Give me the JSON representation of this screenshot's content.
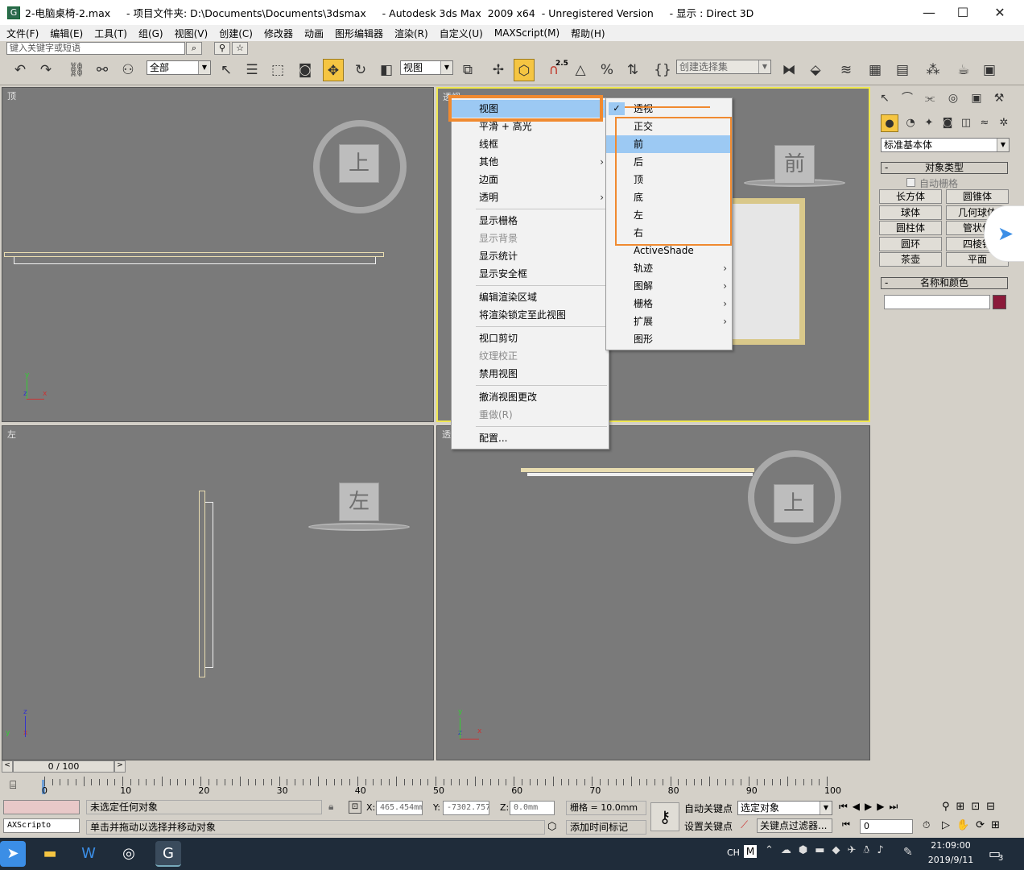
{
  "window": {
    "title": "2-电脑桌椅-2.max     - 项目文件夹: D:\\Documents\\Documents\\3dsmax     - Autodesk 3ds Max  2009 x64  - Unregistered Version     - 显示 : Direct 3D",
    "minimize": "—",
    "maximize": "☐",
    "close": "✕"
  },
  "menubar": [
    "文件(F)",
    "编辑(E)",
    "工具(T)",
    "组(G)",
    "视图(V)",
    "创建(C)",
    "修改器",
    "动画",
    "图形编辑器",
    "渲染(R)",
    "自定义(U)",
    "MAXScript(M)",
    "帮助(H)"
  ],
  "search": {
    "placeholder": "键入关键字或短语"
  },
  "toolbar": {
    "selection_filter": "全部",
    "ref_coord": "视图",
    "named_selection": "创建选择集",
    "snap_value": "2.5"
  },
  "viewports": {
    "top": {
      "label": "顶",
      "cube": "上"
    },
    "perspective": {
      "label": "透视",
      "cube": "前"
    },
    "left": {
      "label": "左",
      "cube": "左"
    },
    "camera": {
      "label": "透",
      "cube": "上"
    }
  },
  "context_menu": {
    "items": [
      {
        "label": "视图",
        "submenu": true,
        "selected": true
      },
      {
        "label": "平滑 + 高光"
      },
      {
        "label": "线框"
      },
      {
        "label": "其他",
        "submenu": true
      },
      {
        "label": "边面"
      },
      {
        "label": "透明",
        "submenu": true
      },
      {
        "sep": true
      },
      {
        "label": "显示栅格"
      },
      {
        "label": "显示背景",
        "disabled": true
      },
      {
        "label": "显示统计"
      },
      {
        "label": "显示安全框"
      },
      {
        "sep": true
      },
      {
        "label": "编辑渲染区域"
      },
      {
        "label": "将渲染锁定至此视图"
      },
      {
        "sep": true
      },
      {
        "label": "视口剪切"
      },
      {
        "label": "纹理校正",
        "disabled": true
      },
      {
        "label": "禁用视图"
      },
      {
        "sep": true
      },
      {
        "label": "撤消视图更改"
      },
      {
        "label": "重做(R)",
        "disabled": true
      },
      {
        "sep": true
      },
      {
        "label": "配置..."
      }
    ]
  },
  "view_submenu": {
    "items": [
      {
        "label": "透视",
        "checked": true
      },
      {
        "label": "正交"
      },
      {
        "label": "前",
        "selected": true
      },
      {
        "label": "后"
      },
      {
        "label": "顶"
      },
      {
        "label": "底"
      },
      {
        "label": "左"
      },
      {
        "label": "右"
      },
      {
        "label": "ActiveShade"
      },
      {
        "label": "轨迹",
        "submenu": true
      },
      {
        "label": "图解",
        "submenu": true
      },
      {
        "label": "栅格",
        "submenu": true
      },
      {
        "label": "扩展",
        "submenu": true
      },
      {
        "label": "图形"
      }
    ]
  },
  "command_panel": {
    "category": "标准基本体",
    "object_type_header": "对象类型",
    "autogrid": "自动栅格",
    "buttons": [
      "长方体",
      "圆锥体",
      "球体",
      "几何球体",
      "圆柱体",
      "管状体",
      "圆环",
      "四棱锥",
      "茶壶",
      "平面"
    ],
    "name_color_header": "名称和颜色",
    "color": "#8b1a3a"
  },
  "timeline": {
    "frame_counter": "0 / 100",
    "ticks": [
      "0",
      "10",
      "20",
      "30",
      "40",
      "50",
      "60",
      "70",
      "80",
      "90",
      "100"
    ]
  },
  "status": {
    "maxscript": "AXScripto",
    "selection": "未选定任何对象",
    "prompt": "单击并拖动以选择并移动对象",
    "x_label": "X:",
    "x": "465.454mm",
    "y_label": "Y:",
    "y": "-7302.757",
    "z_label": "Z:",
    "z": "0.0mm",
    "grid": "栅格 = 10.0mm",
    "add_time_tag": "添加时间标记",
    "auto_key": "自动关键点",
    "set_key": "设置关键点",
    "selected_object": "选定对象",
    "key_filters": "关键点过滤器...",
    "frame": "0"
  },
  "taskbar": {
    "lang": "CH",
    "ime": "M",
    "time": "21:09:00",
    "date": "2019/9/11",
    "notifications": "3"
  }
}
